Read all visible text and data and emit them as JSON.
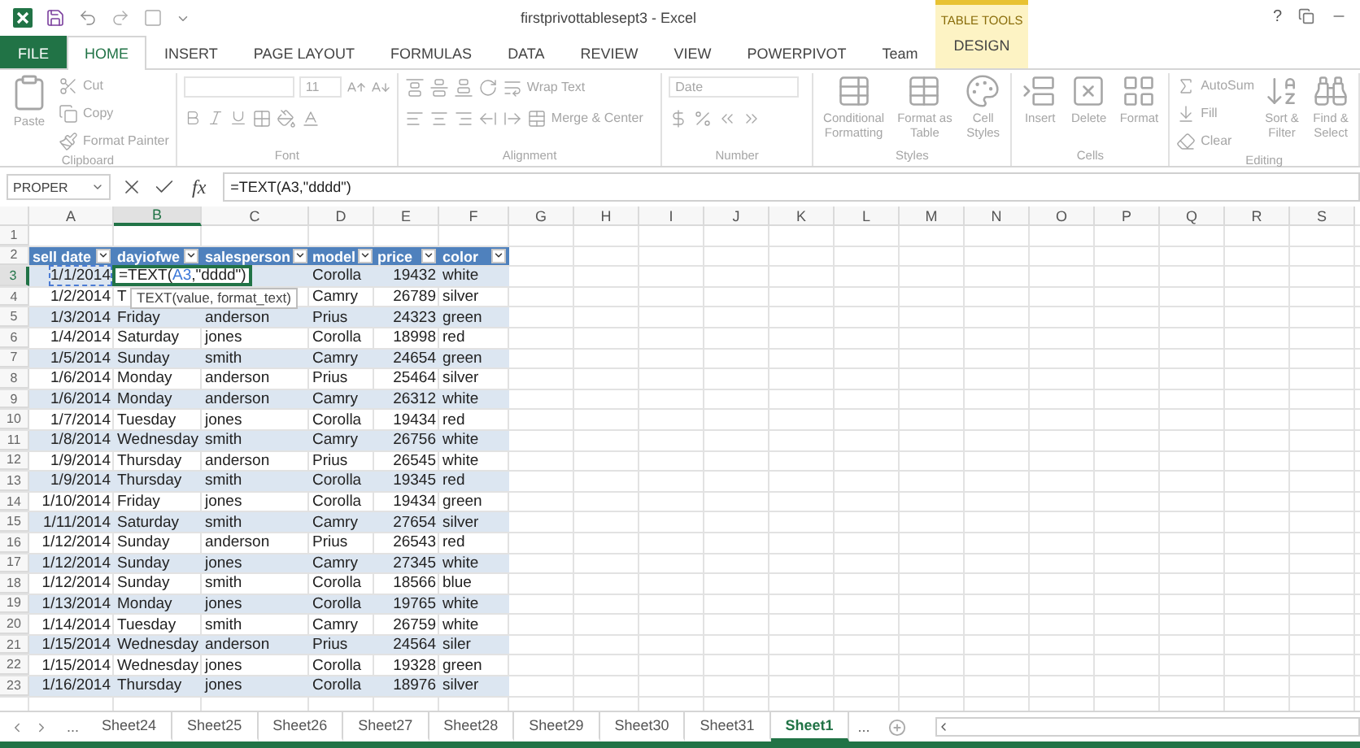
{
  "title_bar": {
    "title": "firstprivottablesept3 - Excel",
    "context_label": "TABLE TOOLS",
    "help": "?"
  },
  "tabs": [
    {
      "label": "FILE",
      "kind": "file",
      "selected": false
    },
    {
      "label": "HOME",
      "kind": "tab",
      "selected": true
    },
    {
      "label": "INSERT",
      "kind": "tab",
      "selected": false
    },
    {
      "label": "PAGE LAYOUT",
      "kind": "tab",
      "selected": false
    },
    {
      "label": "FORMULAS",
      "kind": "tab",
      "selected": false
    },
    {
      "label": "DATA",
      "kind": "tab",
      "selected": false
    },
    {
      "label": "REVIEW",
      "kind": "tab",
      "selected": false
    },
    {
      "label": "VIEW",
      "kind": "tab",
      "selected": false
    },
    {
      "label": "POWERPIVOT",
      "kind": "tab",
      "selected": false
    },
    {
      "label": "Team",
      "kind": "tab",
      "selected": false
    },
    {
      "label": "DESIGN",
      "kind": "context",
      "selected": false
    }
  ],
  "ribbon": {
    "disabled": true,
    "clipboard": {
      "label": "Clipboard",
      "paste": "Paste",
      "cut": "Cut",
      "copy": "Copy",
      "format_painter": "Format Painter"
    },
    "font": {
      "label": "Font",
      "size": "11"
    },
    "alignment": {
      "label": "Alignment",
      "wrap_text": "Wrap Text",
      "merge": "Merge & Center"
    },
    "number": {
      "label": "Number",
      "format": "Date"
    },
    "styles": {
      "label": "Styles",
      "conditional": "Conditional\nFormatting",
      "format_table": "Format as\nTable",
      "cell_styles": "Cell\nStyles"
    },
    "cells": {
      "label": "Cells",
      "insert": "Insert",
      "delete": "Delete",
      "format": "Format"
    },
    "editing": {
      "label": "Editing",
      "autosum": "AutoSum",
      "fill": "Fill",
      "clear": "Clear",
      "sort": "Sort &\nFilter",
      "find": "Find &\nSelect"
    }
  },
  "formula_bar": {
    "name_box": "PROPER",
    "fx": "fx",
    "formula": "=TEXT(A3,\"dddd\")"
  },
  "sheet": {
    "columns": [
      {
        "label": "A",
        "selected": false
      },
      {
        "label": "B",
        "selected": true
      },
      {
        "label": "C",
        "selected": false
      },
      {
        "label": "D",
        "selected": false
      },
      {
        "label": "E",
        "selected": false
      },
      {
        "label": "F",
        "selected": false
      },
      {
        "label": "G",
        "selected": false
      },
      {
        "label": "H",
        "selected": false
      },
      {
        "label": "I",
        "selected": false
      },
      {
        "label": "J",
        "selected": false
      },
      {
        "label": "K",
        "selected": false
      },
      {
        "label": "L",
        "selected": false
      },
      {
        "label": "M",
        "selected": false
      },
      {
        "label": "N",
        "selected": false
      },
      {
        "label": "O",
        "selected": false
      },
      {
        "label": "P",
        "selected": false
      },
      {
        "label": "Q",
        "selected": false
      },
      {
        "label": "R",
        "selected": false
      },
      {
        "label": "S",
        "selected": false
      }
    ],
    "rows": [
      {
        "label": "1",
        "kind": "empty",
        "selected": false,
        "cells": []
      },
      {
        "label": "2",
        "kind": "header",
        "selected": false,
        "cells": [
          "sell date",
          "dayiofwe",
          "salesperson",
          "model",
          "price",
          "color"
        ]
      },
      {
        "label": "3",
        "kind": "data",
        "selected": true,
        "cells": [
          {
            "text": "1/1/2014",
            "referenced": true
          },
          {
            "kind": "editor",
            "segments": [
              {
                "text": "=TEXT(",
                "kind": "plain"
              },
              {
                "text": "A3",
                "kind": "reference"
              },
              {
                "text": ",\"dddd\")",
                "kind": "plain"
              }
            ],
            "tooltip": "TEXT(value, format_text)"
          },
          "",
          "Corolla",
          "19432",
          "white"
        ]
      },
      {
        "label": "4",
        "kind": "data",
        "selected": false,
        "cells": [
          "1/2/2014",
          "T",
          "",
          "Camry",
          "26789",
          "silver"
        ]
      },
      {
        "label": "5",
        "kind": "data",
        "selected": false,
        "cells": [
          "1/3/2014",
          "Friday",
          "anderson",
          "Prius",
          "24323",
          "green"
        ]
      },
      {
        "label": "6",
        "kind": "data",
        "selected": false,
        "cells": [
          "1/4/2014",
          "Saturday",
          "jones",
          "Corolla",
          "18998",
          "red"
        ]
      },
      {
        "label": "7",
        "kind": "data",
        "selected": false,
        "cells": [
          "1/5/2014",
          "Sunday",
          "smith",
          "Camry",
          "24654",
          "green"
        ]
      },
      {
        "label": "8",
        "kind": "data",
        "selected": false,
        "cells": [
          "1/6/2014",
          "Monday",
          "anderson",
          "Prius",
          "25464",
          "silver"
        ]
      },
      {
        "label": "9",
        "kind": "data",
        "selected": false,
        "cells": [
          "1/6/2014",
          "Monday",
          "anderson",
          "Camry",
          "26312",
          "white"
        ]
      },
      {
        "label": "10",
        "kind": "data",
        "selected": false,
        "cells": [
          "1/7/2014",
          "Tuesday",
          "jones",
          "Corolla",
          "19434",
          "red"
        ]
      },
      {
        "label": "11",
        "kind": "data",
        "selected": false,
        "cells": [
          "1/8/2014",
          "Wednesday",
          "smith",
          "Camry",
          "26756",
          "white"
        ]
      },
      {
        "label": "12",
        "kind": "data",
        "selected": false,
        "cells": [
          "1/9/2014",
          "Thursday",
          "anderson",
          "Prius",
          "26545",
          "white"
        ]
      },
      {
        "label": "13",
        "kind": "data",
        "selected": false,
        "cells": [
          "1/9/2014",
          "Thursday",
          "smith",
          "Corolla",
          "19345",
          "red"
        ]
      },
      {
        "label": "14",
        "kind": "data",
        "selected": false,
        "cells": [
          "1/10/2014",
          "Friday",
          "jones",
          "Corolla",
          "19434",
          "green"
        ]
      },
      {
        "label": "15",
        "kind": "data",
        "selected": false,
        "cells": [
          "1/11/2014",
          "Saturday",
          "smith",
          "Camry",
          "27654",
          "silver"
        ]
      },
      {
        "label": "16",
        "kind": "data",
        "selected": false,
        "cells": [
          "1/12/2014",
          "Sunday",
          "anderson",
          "Prius",
          "26543",
          "red"
        ]
      },
      {
        "label": "17",
        "kind": "data",
        "selected": false,
        "cells": [
          "1/12/2014",
          "Sunday",
          "jones",
          "Camry",
          "27345",
          "white"
        ]
      },
      {
        "label": "18",
        "kind": "data",
        "selected": false,
        "cells": [
          "1/12/2014",
          "Sunday",
          "smith",
          "Corolla",
          "18566",
          "blue"
        ]
      },
      {
        "label": "19",
        "kind": "data",
        "selected": false,
        "cells": [
          "1/13/2014",
          "Monday",
          "jones",
          "Corolla",
          "19765",
          "white"
        ]
      },
      {
        "label": "20",
        "kind": "data",
        "selected": false,
        "cells": [
          "1/14/2014",
          "Tuesday",
          "smith",
          "Camry",
          "26759",
          "white"
        ]
      },
      {
        "label": "21",
        "kind": "data",
        "selected": false,
        "cells": [
          "1/15/2014",
          "Wednesday",
          "anderson",
          "Prius",
          "24564",
          "siler"
        ]
      },
      {
        "label": "22",
        "kind": "data",
        "selected": false,
        "cells": [
          "1/15/2014",
          "Wednesday",
          "jones",
          "Corolla",
          "19328",
          "green"
        ]
      },
      {
        "label": "23",
        "kind": "data",
        "selected": false,
        "cells": [
          "1/16/2014",
          "Thursday",
          "jones",
          "Corolla",
          "18976",
          "silver"
        ]
      }
    ]
  },
  "sheet_tabs": {
    "more_left": "...",
    "more_right": "...",
    "tabs": [
      {
        "label": "Sheet24",
        "selected": false
      },
      {
        "label": "Sheet25",
        "selected": false
      },
      {
        "label": "Sheet26",
        "selected": false
      },
      {
        "label": "Sheet27",
        "selected": false
      },
      {
        "label": "Sheet28",
        "selected": false
      },
      {
        "label": "Sheet29",
        "selected": false
      },
      {
        "label": "Sheet30",
        "selected": false
      },
      {
        "label": "Sheet31",
        "selected": false
      },
      {
        "label": "Sheet1",
        "selected": true
      }
    ]
  }
}
